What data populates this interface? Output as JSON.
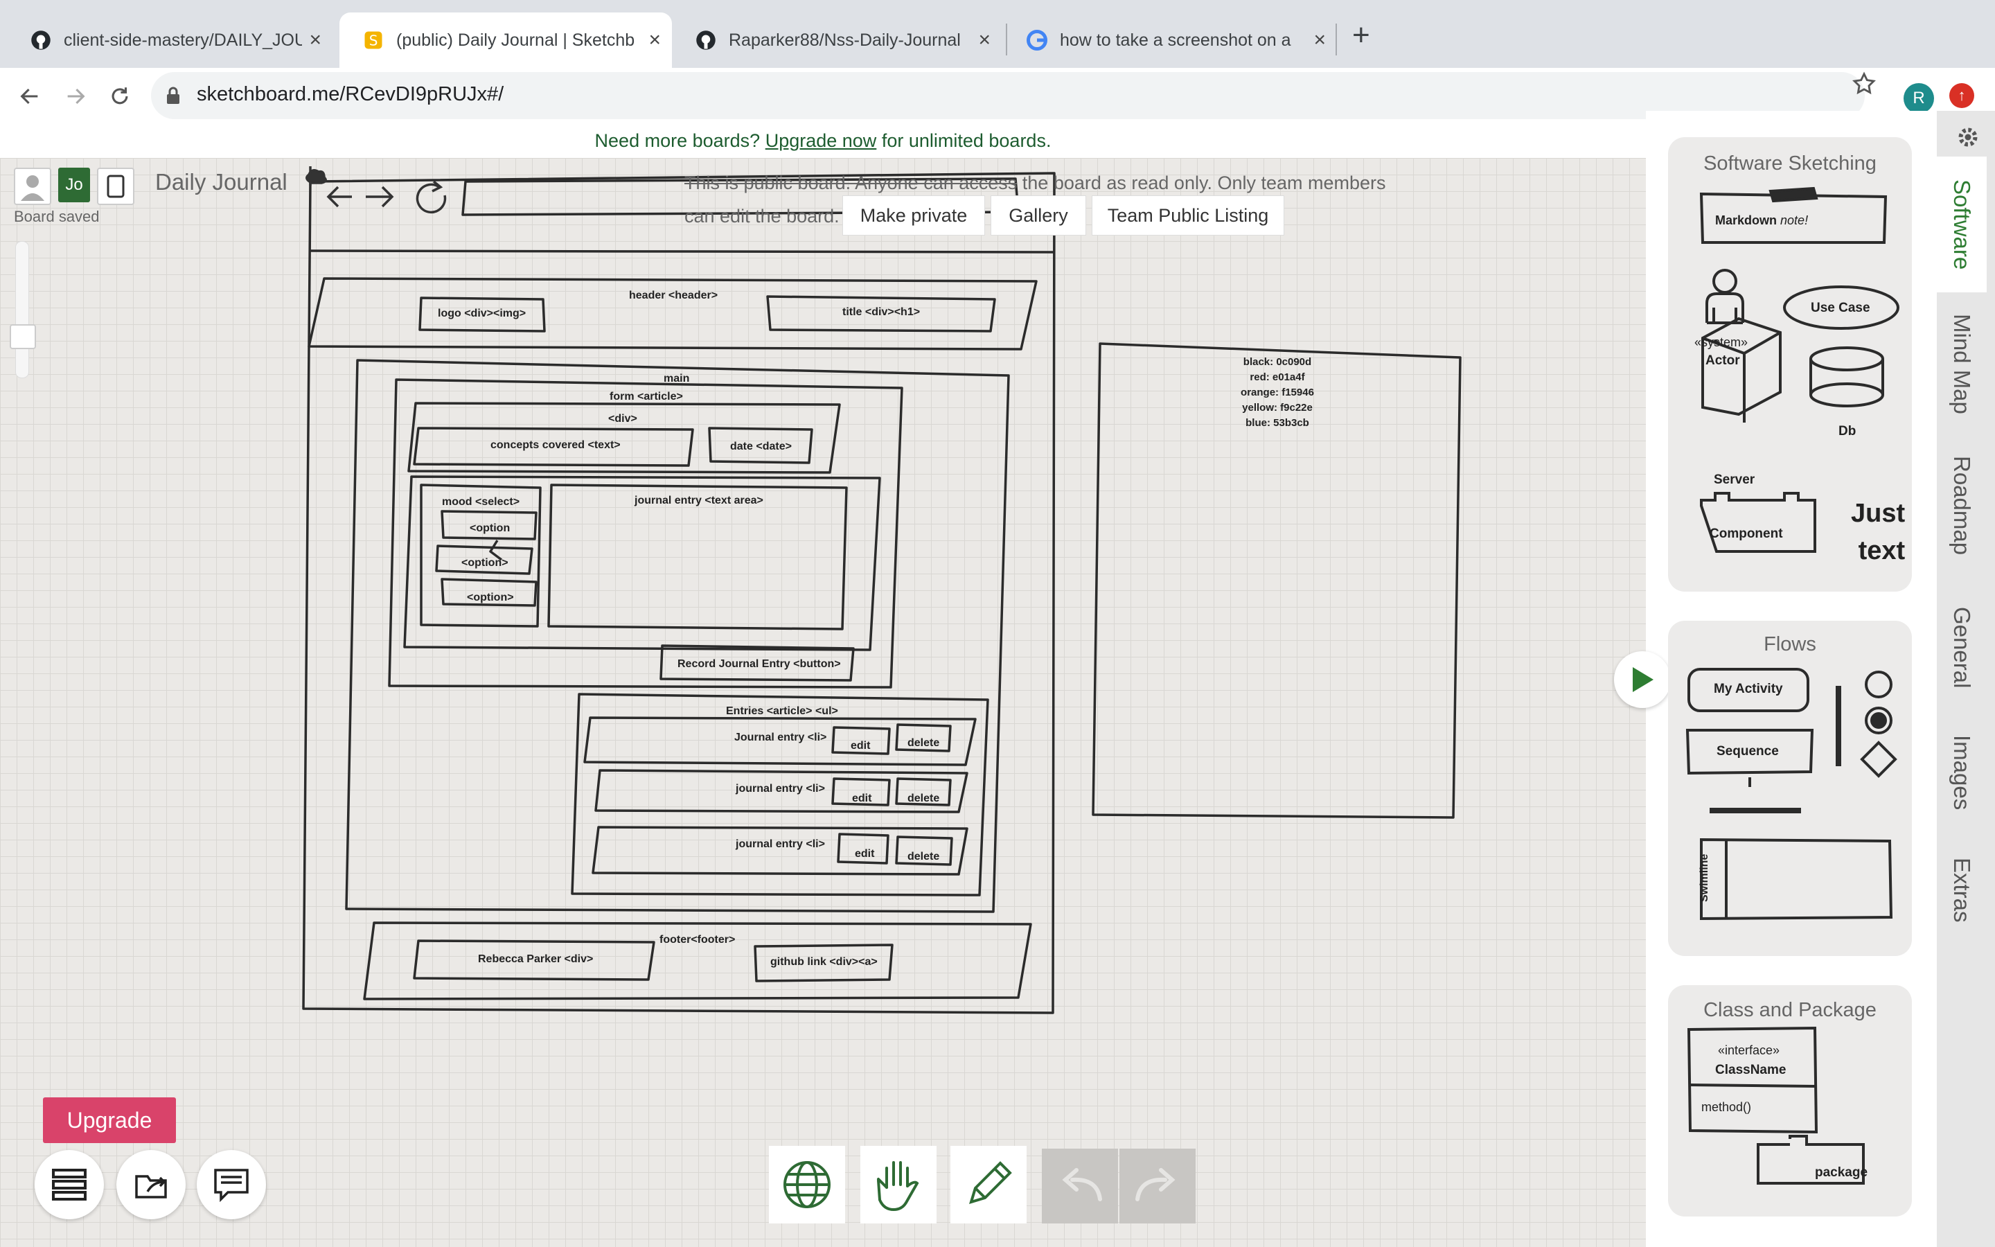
{
  "tabs": [
    {
      "title": "client-side-mastery/DAILY_JOU",
      "icon": "github-icon"
    },
    {
      "title": "(public) Daily Journal | Sketchb",
      "icon": "sketchboard-icon"
    },
    {
      "title": "Raparker88/Nss-Daily-Journal",
      "icon": "github-icon"
    },
    {
      "title": "how to take a screenshot on a",
      "icon": "google-icon"
    }
  ],
  "browser": {
    "url": "sketchboard.me/RCevDI9pRUJx#/",
    "profile_initial": "R"
  },
  "banner": {
    "lead": "Need more boards?",
    "link": "Upgrade now",
    "tail": "for unlimited boards."
  },
  "board": {
    "user_initials": "Jo",
    "title": "Daily Journal",
    "status": "Board saved",
    "public_note_strike": "This is public board. Anyone can access",
    "public_note_rest": "the board as read only. Only team members can edit the board.",
    "buttons": {
      "make_private": "Make private",
      "gallery": "Gallery",
      "team_listing": "Team Public Listing"
    },
    "upgrade": "Upgrade"
  },
  "diagram": {
    "header": "header <header>",
    "logo": "logo <div><img>",
    "title": "title <div><h1>",
    "main": "main",
    "form": "form <article>",
    "div": "<div>",
    "concepts": "concepts covered <text>",
    "date": "date <date>",
    "mood": "mood <select>",
    "option1": "<option",
    "option2": "<option>",
    "option3": "<option>",
    "journal_entry": "journal entry <text area>",
    "record_button": "Record Journal Entry <button>",
    "entries": "Entries <article> <ul>",
    "entry1": "Journal entry <li>",
    "entry2": "journal entry <li>",
    "entry3": "journal entry <li>",
    "edit": "edit",
    "delete": "delete",
    "footer": "footer<footer>",
    "author": "Rebecca Parker <div>",
    "github": "github link <div><a>",
    "colors": [
      "black: 0c090d",
      "red: e01a4f",
      "orange: f15946",
      "yellow: f9c22e",
      "blue: 53b3cb"
    ]
  },
  "palette": {
    "software": {
      "title": "Software Sketching",
      "markdown_bold": "Markdown",
      "markdown_italic": "note!",
      "actor_stereotype": "«system»",
      "actor": "Actor",
      "use_case": "Use Case",
      "server": "Server",
      "db": "Db",
      "component": "Component",
      "just_text_1": "Just",
      "just_text_2": "text"
    },
    "flows": {
      "title": "Flows",
      "activity": "My Activity",
      "sequence": "Sequence",
      "swimline": "Swimline"
    },
    "class_package": {
      "title": "Class and Package",
      "stereotype": "«interface»",
      "class_name": "ClassName",
      "method": "method()",
      "package": "package"
    }
  },
  "vertical_tabs": [
    "Software",
    "Mind Map",
    "Roadmap",
    "General",
    "Images",
    "Extras"
  ],
  "colors": {
    "accent_green": "#2e6b34",
    "upgrade_pink": "#d9436a",
    "canvas": "#ebe9e6"
  }
}
